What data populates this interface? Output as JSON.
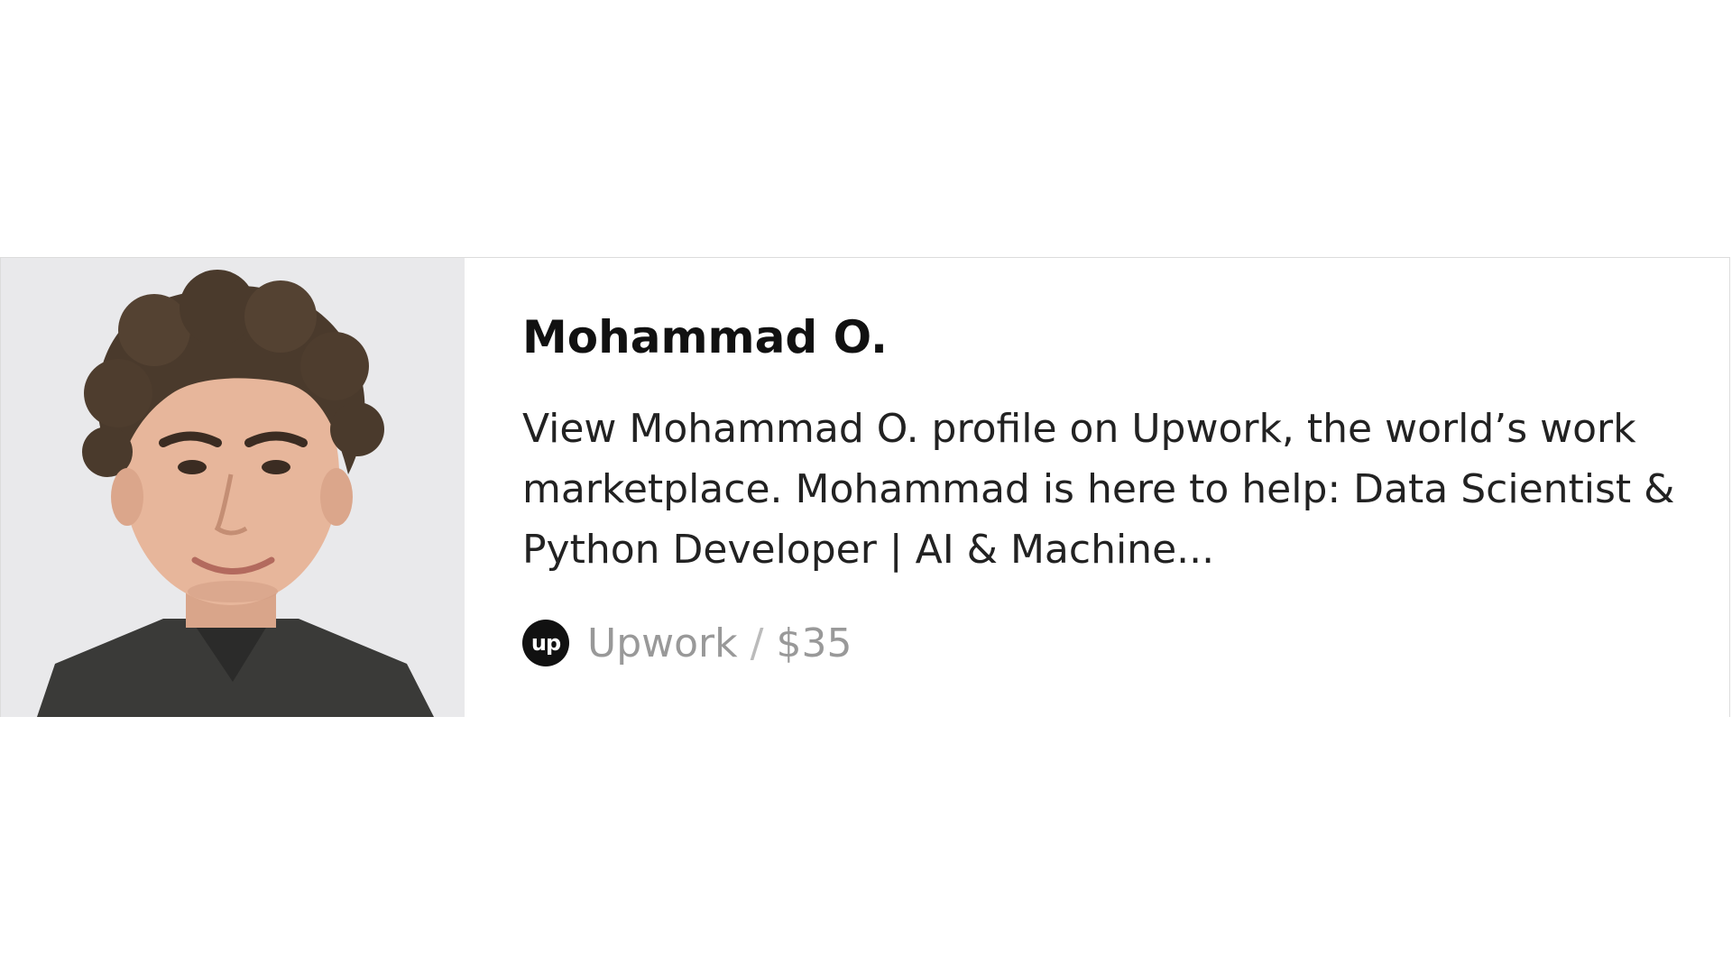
{
  "card": {
    "title": "Mohammad O.",
    "description": "View Mohammad O. profile on Upwork, the world’s work marketplace. Mohammad is here to help: Data Scientist & Python Developer | AI & Machine...",
    "source_name": "Upwork",
    "separator": "/",
    "rate": "$35",
    "logo_text": "up",
    "icons": {
      "logo": "upwork-logo-icon",
      "avatar": "profile-photo"
    },
    "colors": {
      "title": "#111111",
      "description": "#222222",
      "source": "#999999",
      "logo_bg": "#111111"
    }
  }
}
